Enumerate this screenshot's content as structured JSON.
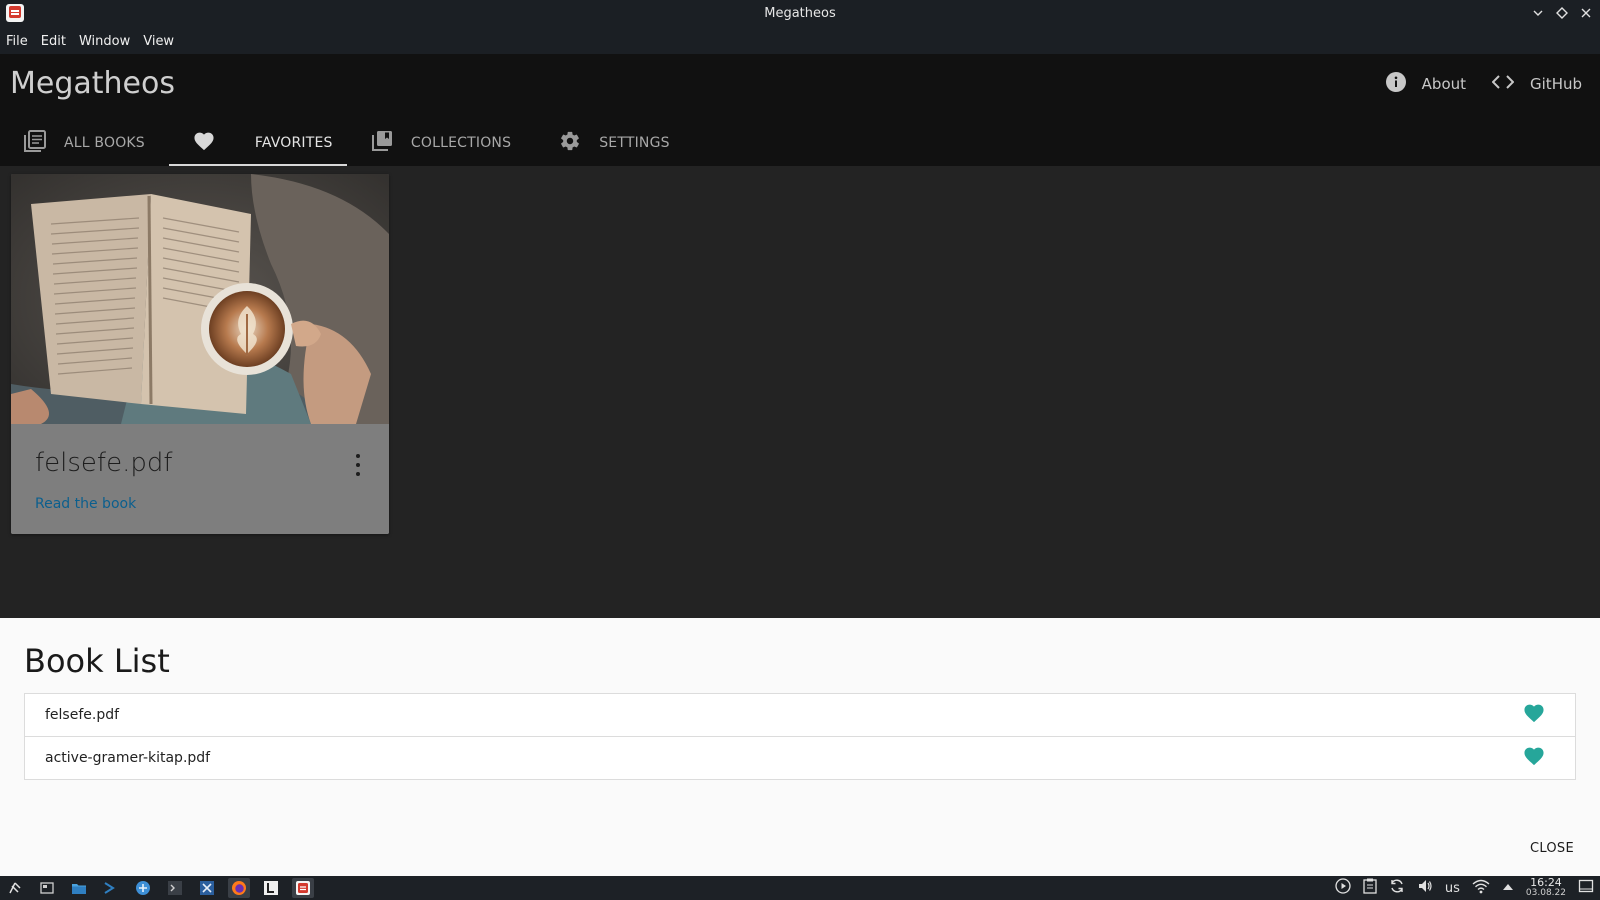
{
  "window": {
    "title": "Megatheos",
    "controls": [
      "minimize-icon",
      "maximize-icon",
      "close-icon"
    ]
  },
  "menubar": {
    "items": [
      "File",
      "Edit",
      "Window",
      "View"
    ]
  },
  "appbar": {
    "brand": "Megatheos",
    "links": [
      {
        "label": "About",
        "icon": "info-icon"
      },
      {
        "label": "GitHub",
        "icon": "code-icon"
      }
    ],
    "tabs": [
      {
        "label": "ALL BOOKS",
        "icon": "library-icon",
        "active": false
      },
      {
        "label": "FAVORITES",
        "icon": "heart-icon",
        "active": true
      },
      {
        "label": "COLLECTIONS",
        "icon": "collections-icon",
        "active": false
      },
      {
        "label": "SETTINGS",
        "icon": "gear-icon",
        "active": false
      }
    ]
  },
  "card": {
    "title": "felsefe.pdf",
    "link_label": "Read the book",
    "image": "book-and-coffee-photo"
  },
  "sheet": {
    "title": "Book List",
    "items": [
      {
        "name": "felsefe.pdf",
        "favorite": true
      },
      {
        "name": "active-gramer-kitap.pdf",
        "favorite": true
      }
    ],
    "close_label": "CLOSE"
  },
  "taskbar": {
    "layout": "us",
    "time": "16:24",
    "date": "03.08.22"
  },
  "colors": {
    "accent_teal": "#26a69a",
    "link_blue": "#0b5f8e",
    "appbar_bg": "#111111",
    "content_bg": "#232323"
  }
}
